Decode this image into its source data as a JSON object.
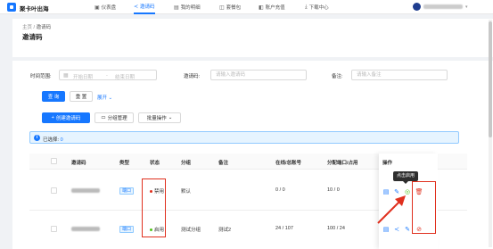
{
  "app": {
    "brand": "聚卡叶出海"
  },
  "nav": [
    {
      "icon": "dashboard-icon",
      "glyph": "▣",
      "label": "仪表盘"
    },
    {
      "icon": "share-icon",
      "glyph": "≺",
      "label": "邀请码"
    },
    {
      "icon": "wallet-icon",
      "glyph": "▤",
      "label": "我的明细"
    },
    {
      "icon": "package-icon",
      "glyph": "◫",
      "label": "套餐包"
    },
    {
      "icon": "recharge-icon",
      "glyph": "◧",
      "label": "账户充值"
    },
    {
      "icon": "download-icon",
      "glyph": "⤓",
      "label": "下载中心"
    }
  ],
  "breadcrumb": {
    "home": "主页",
    "sep": "/",
    "current": "邀请码"
  },
  "page_title": "邀请码",
  "filters": {
    "time_label": "时间范围:",
    "start_placeholder": "开始日期",
    "range_sep": "-",
    "end_placeholder": "结束日期",
    "code_label": "邀请码:",
    "code_placeholder": "请输入邀请码",
    "note_label": "备注:",
    "note_placeholder": "请输入备注"
  },
  "actions": {
    "search": "查 询",
    "reset": "重 置",
    "expand": "展开",
    "create": "创建邀请码",
    "group": "分组管理",
    "batch": "批量操作"
  },
  "selection": {
    "text": "已选择:",
    "count": "0"
  },
  "table": {
    "headers": [
      "邀请码",
      "类型",
      "状态",
      "分组",
      "备注",
      "在线/总账号",
      "分配端口/占用",
      "操作"
    ],
    "rows": [
      {
        "type": "端口",
        "status": "禁用",
        "status_color": "#e0301e",
        "group": "默认",
        "note": "",
        "online": "0 / 0",
        "ports": "10 / 0"
      },
      {
        "type": "端口",
        "status": "启用",
        "status_color": "#52c41a",
        "group": "测试分组",
        "note": "测试2",
        "online": "24 / 107",
        "ports": "100 / 24"
      }
    ]
  },
  "tooltip": "点击启用",
  "colors": {
    "primary": "#1677ff",
    "annotation": "#e0301e",
    "enabled": "#52c41a"
  }
}
